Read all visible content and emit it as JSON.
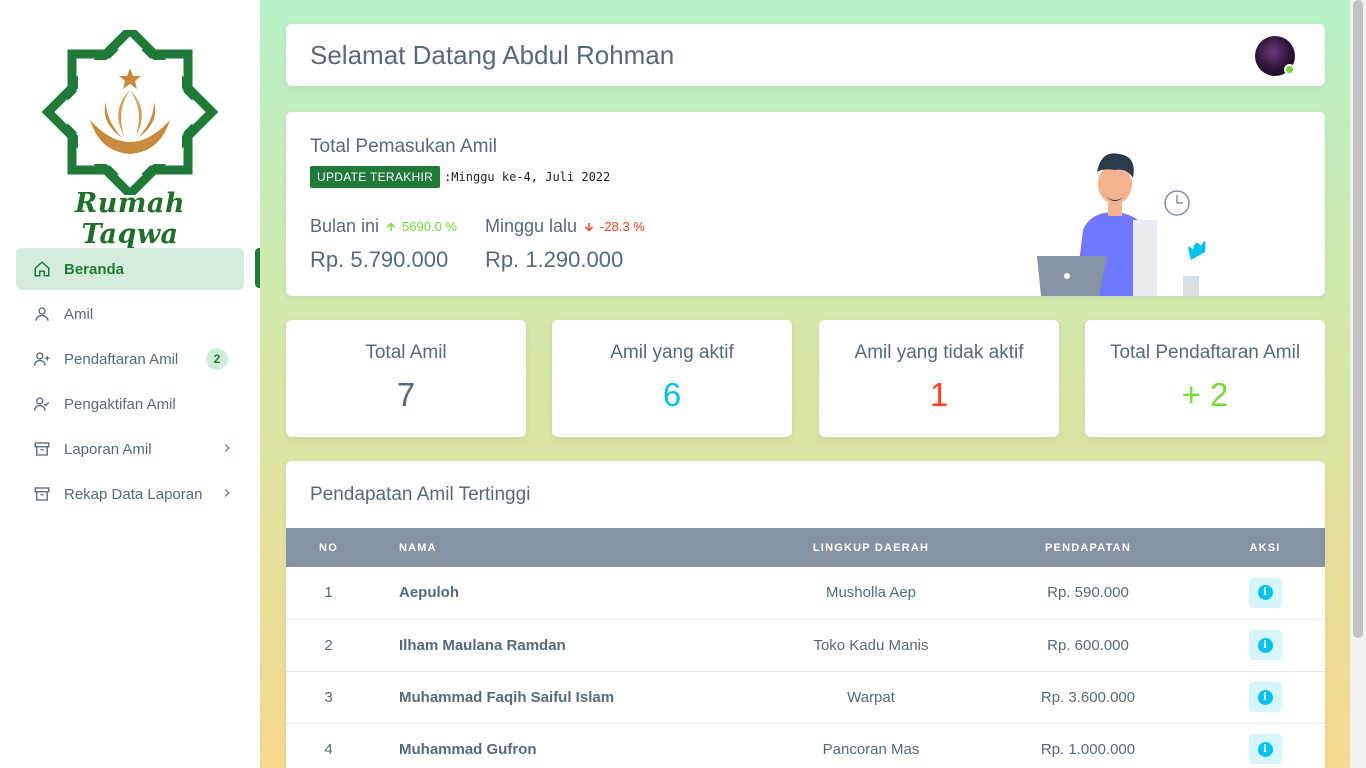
{
  "brand": {
    "logo_text": "Rumah Taqwa"
  },
  "sidebar": {
    "items": [
      {
        "label": "Beranda",
        "icon": "home-icon"
      },
      {
        "label": "Amil",
        "icon": "user-icon"
      },
      {
        "label": "Pendaftaran Amil",
        "icon": "user-plus-icon",
        "badge": "2"
      },
      {
        "label": "Pengaktifan Amil",
        "icon": "user-check-icon"
      },
      {
        "label": "Laporan Amil",
        "icon": "archive-icon"
      },
      {
        "label": "Rekap Data Laporan",
        "icon": "archive-icon"
      }
    ]
  },
  "header": {
    "greeting": "Selamat Datang Abdul Rohman"
  },
  "income": {
    "title": "Total Pemasukan Amil",
    "update_label": "UPDATE TERAKHIR",
    "update_value": ":Minggu ke-4, Juli 2022",
    "this_month": {
      "label": "Bulan ini",
      "change": "5690.0 %",
      "amount": "Rp. 5.790.000"
    },
    "last_week": {
      "label": "Minggu lalu",
      "change": "-28.3 %",
      "amount": "Rp. 1.290.000"
    }
  },
  "summary": [
    {
      "title": "Total Amil",
      "value": "7",
      "color": "#566a7f"
    },
    {
      "title": "Amil yang aktif",
      "value": "6",
      "color": "#03c3ec"
    },
    {
      "title": "Amil yang tidak aktif",
      "value": "1",
      "color": "#ff3e1d"
    },
    {
      "title": "Total Pendaftaran Amil",
      "value": "+ 2",
      "color": "#71dd37"
    }
  ],
  "table": {
    "title": "Pendapatan Amil Tertinggi",
    "columns": [
      "NO",
      "NAMA",
      "LINGKUP DAERAH",
      "PENDAPATAN",
      "AKSI"
    ],
    "rows": [
      {
        "no": "1",
        "nama": "Aepuloh",
        "daerah": "Musholla Aep",
        "pendapatan": "Rp. 590.000"
      },
      {
        "no": "2",
        "nama": "Ilham Maulana Ramdan",
        "daerah": "Toko Kadu Manis",
        "pendapatan": "Rp. 600.000"
      },
      {
        "no": "3",
        "nama": "Muhammad Faqih Saiful Islam",
        "daerah": "Warpat",
        "pendapatan": "Rp. 3.600.000"
      },
      {
        "no": "4",
        "nama": "Muhammad Gufron",
        "daerah": "Pancoran Mas",
        "pendapatan": "Rp. 1.000.000"
      }
    ]
  }
}
